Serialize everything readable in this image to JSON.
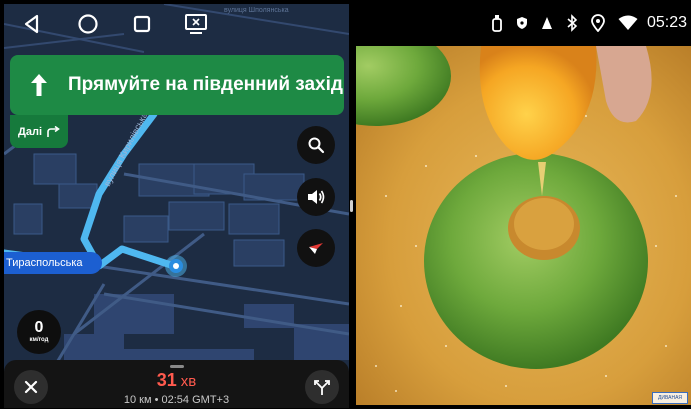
{
  "navigation": {
    "instruction": "Прямуйте на південний захід",
    "next_label": "Далі",
    "street_name": "Тираспольська",
    "map_street_label": "вулиця Кирилівська",
    "map_street_label_top": "вулиця Шполянська",
    "speed": {
      "value": "0",
      "unit": "км/год"
    },
    "eta": {
      "minutes": "31",
      "unit": "хв",
      "details": "10 км • 02:54 GMT+3"
    }
  },
  "status_bar": {
    "time": "05:23"
  },
  "watermark": {
    "text": "ДИВАНАЯ"
  },
  "colors": {
    "map_bg": "#1d2c43",
    "route": "#4fb8f0",
    "instruction_bg": "#1e8a45",
    "eta": "#ff5a4e"
  },
  "icons": {
    "system": [
      "back-icon",
      "home-icon",
      "recent-apps-icon",
      "screen-mirror-icon"
    ],
    "status": [
      "usb-icon",
      "shield-icon",
      "signal-icon",
      "bluetooth-icon",
      "location-icon",
      "wifi-icon"
    ],
    "map_buttons": [
      "search-icon",
      "volume-icon",
      "compass-icon"
    ],
    "bottom": [
      "close-icon",
      "route-options-icon"
    ]
  }
}
